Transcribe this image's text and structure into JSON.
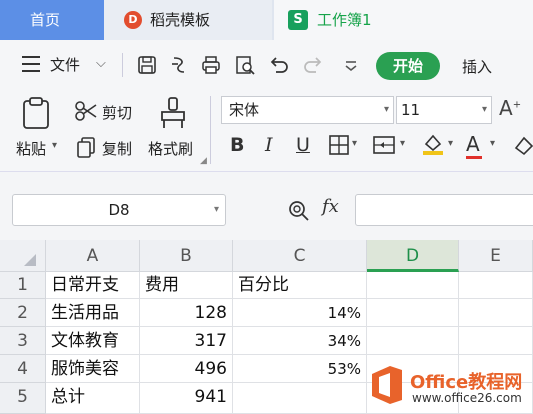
{
  "tabs": {
    "home": "首页",
    "daoke": "稻壳模板",
    "daoke_logo": "D",
    "workbook": "工作簿1",
    "workbook_logo": "S"
  },
  "toolbar": {
    "file": "文件",
    "start": "开始",
    "insert": "插入"
  },
  "ribbon": {
    "paste": "粘贴",
    "cut": "剪切",
    "copy": "复制",
    "format_painter": "格式刷",
    "font_name": "宋体",
    "font_size": "11",
    "bold": "B",
    "italic": "I",
    "underline": "U",
    "font_color_glyph": "A"
  },
  "formula_bar": {
    "cell_ref": "D8",
    "fx": "fx"
  },
  "sheet": {
    "columns": [
      "A",
      "B",
      "C",
      "D",
      "E"
    ],
    "rows": [
      "1",
      "2",
      "3",
      "4",
      "5"
    ],
    "cells": {
      "A1": "日常开支",
      "B1": "费用",
      "C1": "百分比",
      "A2": "生活用品",
      "B2": "128",
      "C2": "14%",
      "A3": "文体教育",
      "B3": "317",
      "C3": "34%",
      "A4": "服饰美容",
      "B4": "496",
      "C4": "53%",
      "A5": "总计",
      "B5": "941"
    }
  },
  "watermark": {
    "title": "Office教程网",
    "url": "www.office26.com"
  },
  "colors": {
    "accent": "#2aa052",
    "home_tab": "#5c8fe6"
  }
}
